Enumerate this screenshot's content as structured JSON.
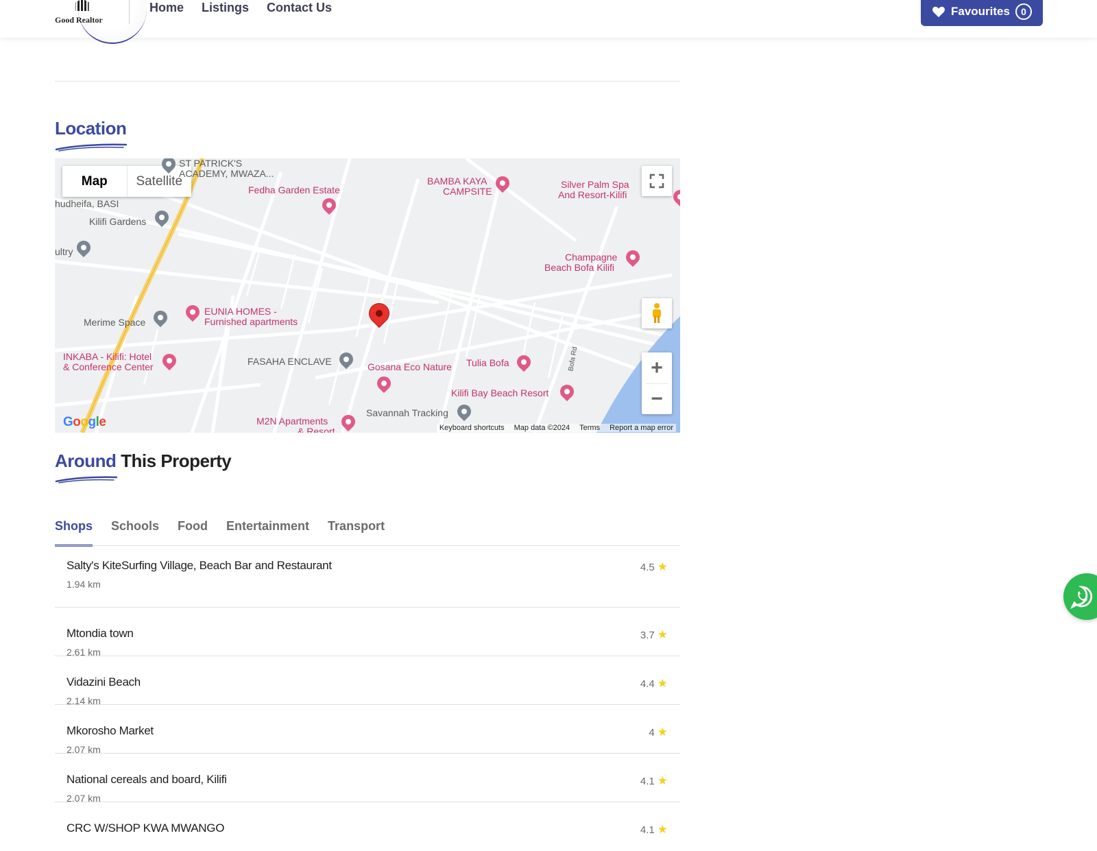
{
  "header": {
    "logo_text": "Good Realtor",
    "nav": [
      "Home",
      "Listings",
      "Contact Us"
    ],
    "favourites_label": "Favourites",
    "favourites_count": "0",
    "accent_color": "#3b4aa0"
  },
  "location": {
    "title": "Location"
  },
  "map": {
    "type_options": [
      "Map",
      "Satellite"
    ],
    "selected_type": "Map",
    "pois": [
      {
        "label": "ST PATRICK'S",
        "kind": "gray"
      },
      {
        "label": "ACADEMY, MWAZA...",
        "kind": "gray"
      },
      {
        "label": "Fedha Garden Estate",
        "kind": "pink"
      },
      {
        "label": "BAMBA KAYA",
        "kind": "pink"
      },
      {
        "label": "CAMPSITE",
        "kind": "pink"
      },
      {
        "label": "Silver Palm Spa",
        "kind": "pink"
      },
      {
        "label": "And Resort-Kilifi",
        "kind": "pink"
      },
      {
        "label": "hudheifa, BASI",
        "kind": "gray"
      },
      {
        "label": "Kilifi Gardens",
        "kind": "gray"
      },
      {
        "label": "ultry",
        "kind": "gray"
      },
      {
        "label": "Champagne",
        "kind": "pink"
      },
      {
        "label": "Beach Bofa Kilifi",
        "kind": "pink"
      },
      {
        "label": "EUNIA HOMES -",
        "kind": "pink"
      },
      {
        "label": "Furnished apartments",
        "kind": "pink"
      },
      {
        "label": "Merime Space",
        "kind": "gray"
      },
      {
        "label": "INKABA - Kilifi: Hotel",
        "kind": "pink"
      },
      {
        "label": "& Conference Center",
        "kind": "pink"
      },
      {
        "label": "FASAHA ENCLAVE",
        "kind": "gray"
      },
      {
        "label": "Gosana Eco Nature",
        "kind": "pink"
      },
      {
        "label": "Tulia Bofa",
        "kind": "pink"
      },
      {
        "label": "Kilifi Bay Beach Resort",
        "kind": "pink"
      },
      {
        "label": "Savannah Tracking",
        "kind": "gray"
      },
      {
        "label": "M2N Apartments",
        "kind": "pink"
      },
      {
        "label": "& Resort",
        "kind": "pink"
      },
      {
        "label": "Bofa Rd",
        "kind": "gray"
      }
    ],
    "footer": [
      "Keyboard shortcuts",
      "Map data ©2024",
      "Terms",
      "Report a map error"
    ],
    "logo": "Google"
  },
  "around": {
    "title_accent": "Around",
    "title_rest": "This Property",
    "tabs": [
      "Shops",
      "Schools",
      "Food",
      "Entertainment",
      "Transport"
    ],
    "active_tab": "Shops",
    "places": [
      {
        "name": "Salty's KiteSurfing Village, Beach Bar and Restaurant",
        "distance": "1.94 km",
        "rating": "4.5"
      },
      {
        "name": "Mtondia town",
        "distance": "2.61 km",
        "rating": "3.7"
      },
      {
        "name": "Vidazini Beach",
        "distance": "2.14 km",
        "rating": "4.4"
      },
      {
        "name": "Mkorosho Market",
        "distance": "2.07 km",
        "rating": "4"
      },
      {
        "name": "National cereals and board, Kilifi",
        "distance": "2.07 km",
        "rating": "4.1"
      },
      {
        "name": "CRC W/SHOP KWA MWANGO",
        "distance": "",
        "rating": "4.1"
      }
    ]
  },
  "whatsapp": {
    "icon": "whatsapp-icon",
    "color": "#2fba53"
  }
}
